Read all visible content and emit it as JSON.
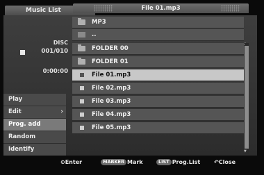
{
  "window": {
    "title": "Music List"
  },
  "info": {
    "disc_label": "DISC",
    "disc_count": "001/010",
    "time": "0:00:00"
  },
  "menu": [
    {
      "label": "Play",
      "active": false
    },
    {
      "label": "Edit",
      "active": false,
      "has_submenu": true
    },
    {
      "label": "Prog. add",
      "active": true
    },
    {
      "label": "Random",
      "active": false
    },
    {
      "label": "Identify",
      "active": false
    }
  ],
  "list": {
    "header": "File 01.mp3",
    "rows": [
      {
        "label": "MP3",
        "type": "root-folder"
      },
      {
        "label": "..",
        "type": "up"
      },
      {
        "label": "FOLDER 00",
        "type": "folder"
      },
      {
        "label": "FOLDER 01",
        "type": "folder"
      },
      {
        "label": "File 01.mp3",
        "type": "file",
        "selected": true
      },
      {
        "label": "File 02.mp3",
        "type": "file"
      },
      {
        "label": "File 03.mp3",
        "type": "file"
      },
      {
        "label": "File 04.mp3",
        "type": "file"
      },
      {
        "label": "File 05.mp3",
        "type": "file"
      }
    ]
  },
  "footer": {
    "enter_label": "Enter",
    "marker_badge": "MARKER",
    "mark_label": "Mark",
    "list_badge": "LIST",
    "proglist_label": "Prog.List",
    "close_label": "Close"
  },
  "colors": {
    "panel": "#353535",
    "row": "#555555",
    "selected_row": "#c8c8c8",
    "background": "#000000"
  }
}
